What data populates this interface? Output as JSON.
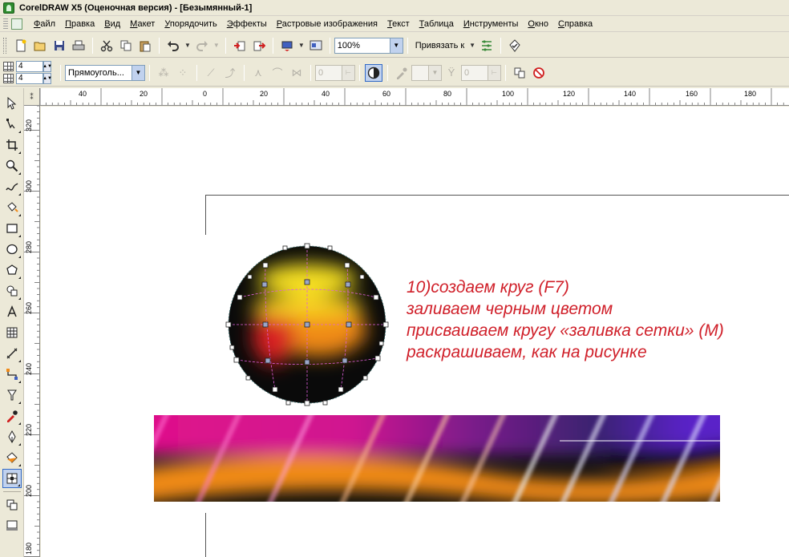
{
  "window": {
    "title": "CorelDRAW X5 (Оценочная версия) - [Безымянный-1]"
  },
  "menu": [
    {
      "label": "Файл",
      "key": "Ф",
      "rest": "айл"
    },
    {
      "label": "Правка",
      "key": "П",
      "rest": "равка"
    },
    {
      "label": "Вид",
      "key": "В",
      "rest": "ид"
    },
    {
      "label": "Макет",
      "key": "М",
      "rest": "акет"
    },
    {
      "label": "Упорядочить",
      "key": "У",
      "rest": "порядочить"
    },
    {
      "label": "Эффекты",
      "key": "Э",
      "rest": "ффекты"
    },
    {
      "label": "Растровые изображения",
      "key": "Р",
      "rest": "астровые изображения"
    },
    {
      "label": "Текст",
      "key": "Т",
      "rest": "екст"
    },
    {
      "label": "Таблица",
      "key": "Т",
      "rest": "аблица"
    },
    {
      "label": "Инструменты",
      "key": "И",
      "rest": "нструменты"
    },
    {
      "label": "Окно",
      "key": "О",
      "rest": "кно"
    },
    {
      "label": "Справка",
      "key": "С",
      "rest": "правка"
    }
  ],
  "toolbar": {
    "zoom_value": "100%",
    "snap_label": "Привязать к"
  },
  "propbar": {
    "rows_value": "4",
    "cols_value": "4",
    "selection_mode": "Прямоуголь...",
    "smoothing_value": "0",
    "transparency_value": "0"
  },
  "ruler": {
    "h_labels": [
      "40",
      "20",
      "0",
      "20",
      "40",
      "60",
      "80",
      "100",
      "120",
      "140",
      "160",
      "180"
    ],
    "v_labels": [
      "320",
      "300",
      "280",
      "260",
      "240",
      "220",
      "200",
      "180"
    ]
  },
  "instructions": {
    "line1": "10)создаем круг (F7)",
    "line2": "заливаем черным цветом",
    "line3": "присваиваем кругу «заливка сетки» (M)",
    "line4": "раскрашиваем, как на рисунке"
  },
  "colors": {
    "accent": "#d0202a",
    "magenta": "#e0108a",
    "orange": "#f08a18",
    "yellow": "#f6e020",
    "red": "#d82020",
    "violet": "#5a20c8"
  },
  "icons": {
    "new": "new-document-icon",
    "open": "open-folder-icon",
    "save": "save-disk-icon",
    "print": "printer-icon",
    "cut": "scissors-icon",
    "copy": "copy-icon",
    "paste": "paste-icon",
    "undo": "undo-icon",
    "redo": "redo-icon",
    "import": "import-icon",
    "export": "export-icon",
    "launcher": "app-launcher-icon",
    "welcome": "welcome-screen-icon",
    "options": "options-icon",
    "grid": "grid-icon"
  }
}
